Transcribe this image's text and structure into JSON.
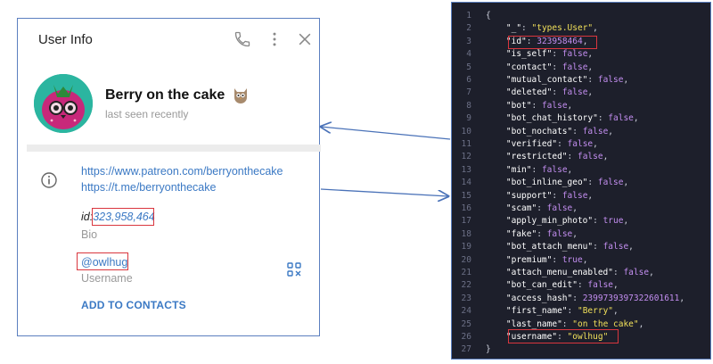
{
  "dialog": {
    "title": "User Info",
    "name": "Berry on the cake",
    "status": "last seen recently",
    "links": [
      "https://www.patreon.com/berryonthecake",
      "https://t.me/berryonthecake"
    ],
    "id_prefix": "id:",
    "id_value": "323,958,464",
    "bio_label": "Bio",
    "username": "@owlhug",
    "username_label": "Username",
    "add_contacts": "ADD TO CONTACTS",
    "icons": [
      "phone-icon",
      "more-vertical-icon",
      "close-icon",
      "info-icon",
      "qr-code-icon"
    ],
    "colors": {
      "link": "#3b79c4",
      "highlight": "#d9363e",
      "avatar_bg": "#2bb5a0"
    }
  },
  "code": {
    "lines": [
      {
        "n": "1",
        "t": [
          [
            "p",
            "{"
          ]
        ]
      },
      {
        "n": "2",
        "t": [
          [
            "k",
            "    \"_\""
          ],
          [
            "p",
            ": "
          ],
          [
            "s",
            "\"types.User\""
          ],
          [
            "p",
            ","
          ]
        ]
      },
      {
        "n": "3",
        "t": [
          [
            "k",
            "    \"id\""
          ],
          [
            "p",
            ": "
          ],
          [
            "n",
            "323958464"
          ],
          [
            "p",
            ","
          ]
        ]
      },
      {
        "n": "4",
        "t": [
          [
            "k",
            "    \"is_self\""
          ],
          [
            "p",
            ": "
          ],
          [
            "b",
            "false"
          ],
          [
            "p",
            ","
          ]
        ]
      },
      {
        "n": "5",
        "t": [
          [
            "k",
            "    \"contact\""
          ],
          [
            "p",
            ": "
          ],
          [
            "b",
            "false"
          ],
          [
            "p",
            ","
          ]
        ]
      },
      {
        "n": "6",
        "t": [
          [
            "k",
            "    \"mutual_contact\""
          ],
          [
            "p",
            ": "
          ],
          [
            "b",
            "false"
          ],
          [
            "p",
            ","
          ]
        ]
      },
      {
        "n": "7",
        "t": [
          [
            "k",
            "    \"deleted\""
          ],
          [
            "p",
            ": "
          ],
          [
            "b",
            "false"
          ],
          [
            "p",
            ","
          ]
        ]
      },
      {
        "n": "8",
        "t": [
          [
            "k",
            "    \"bot\""
          ],
          [
            "p",
            ": "
          ],
          [
            "b",
            "false"
          ],
          [
            "p",
            ","
          ]
        ]
      },
      {
        "n": "9",
        "t": [
          [
            "k",
            "    \"bot_chat_history\""
          ],
          [
            "p",
            ": "
          ],
          [
            "b",
            "false"
          ],
          [
            "p",
            ","
          ]
        ]
      },
      {
        "n": "10",
        "t": [
          [
            "k",
            "    \"bot_nochats\""
          ],
          [
            "p",
            ": "
          ],
          [
            "b",
            "false"
          ],
          [
            "p",
            ","
          ]
        ]
      },
      {
        "n": "11",
        "t": [
          [
            "k",
            "    \"verified\""
          ],
          [
            "p",
            ": "
          ],
          [
            "b",
            "false"
          ],
          [
            "p",
            ","
          ]
        ]
      },
      {
        "n": "12",
        "t": [
          [
            "k",
            "    \"restricted\""
          ],
          [
            "p",
            ": "
          ],
          [
            "b",
            "false"
          ],
          [
            "p",
            ","
          ]
        ]
      },
      {
        "n": "13",
        "t": [
          [
            "k",
            "    \"min\""
          ],
          [
            "p",
            ": "
          ],
          [
            "b",
            "false"
          ],
          [
            "p",
            ","
          ]
        ]
      },
      {
        "n": "14",
        "t": [
          [
            "k",
            "    \"bot_inline_geo\""
          ],
          [
            "p",
            ": "
          ],
          [
            "b",
            "false"
          ],
          [
            "p",
            ","
          ]
        ]
      },
      {
        "n": "15",
        "t": [
          [
            "k",
            "    \"support\""
          ],
          [
            "p",
            ": "
          ],
          [
            "b",
            "false"
          ],
          [
            "p",
            ","
          ]
        ]
      },
      {
        "n": "16",
        "t": [
          [
            "k",
            "    \"scam\""
          ],
          [
            "p",
            ": "
          ],
          [
            "b",
            "false"
          ],
          [
            "p",
            ","
          ]
        ]
      },
      {
        "n": "17",
        "t": [
          [
            "k",
            "    \"apply_min_photo\""
          ],
          [
            "p",
            ": "
          ],
          [
            "b",
            "true"
          ],
          [
            "p",
            ","
          ]
        ]
      },
      {
        "n": "18",
        "t": [
          [
            "k",
            "    \"fake\""
          ],
          [
            "p",
            ": "
          ],
          [
            "b",
            "false"
          ],
          [
            "p",
            ","
          ]
        ]
      },
      {
        "n": "19",
        "t": [
          [
            "k",
            "    \"bot_attach_menu\""
          ],
          [
            "p",
            ": "
          ],
          [
            "b",
            "false"
          ],
          [
            "p",
            ","
          ]
        ]
      },
      {
        "n": "20",
        "t": [
          [
            "k",
            "    \"premium\""
          ],
          [
            "p",
            ": "
          ],
          [
            "b",
            "true"
          ],
          [
            "p",
            ","
          ]
        ]
      },
      {
        "n": "21",
        "t": [
          [
            "k",
            "    \"attach_menu_enabled\""
          ],
          [
            "p",
            ": "
          ],
          [
            "b",
            "false"
          ],
          [
            "p",
            ","
          ]
        ]
      },
      {
        "n": "22",
        "t": [
          [
            "k",
            "    \"bot_can_edit\""
          ],
          [
            "p",
            ": "
          ],
          [
            "b",
            "false"
          ],
          [
            "p",
            ","
          ]
        ]
      },
      {
        "n": "23",
        "t": [
          [
            "k",
            "    \"access_hash\""
          ],
          [
            "p",
            ": "
          ],
          [
            "n",
            "2399739397322601611"
          ],
          [
            "p",
            ","
          ]
        ]
      },
      {
        "n": "24",
        "t": [
          [
            "k",
            "    \"first_name\""
          ],
          [
            "p",
            ": "
          ],
          [
            "s",
            "\"Berry\""
          ],
          [
            "p",
            ","
          ]
        ]
      },
      {
        "n": "25",
        "t": [
          [
            "k",
            "    \"last_name\""
          ],
          [
            "p",
            ": "
          ],
          [
            "s",
            "\"on the cake\""
          ],
          [
            "p",
            ","
          ]
        ]
      },
      {
        "n": "26",
        "t": [
          [
            "k",
            "    \"username\""
          ],
          [
            "p",
            ": "
          ],
          [
            "s",
            "\"owlhug\""
          ]
        ]
      },
      {
        "n": "27",
        "t": [
          [
            "p",
            "}"
          ]
        ]
      }
    ]
  }
}
